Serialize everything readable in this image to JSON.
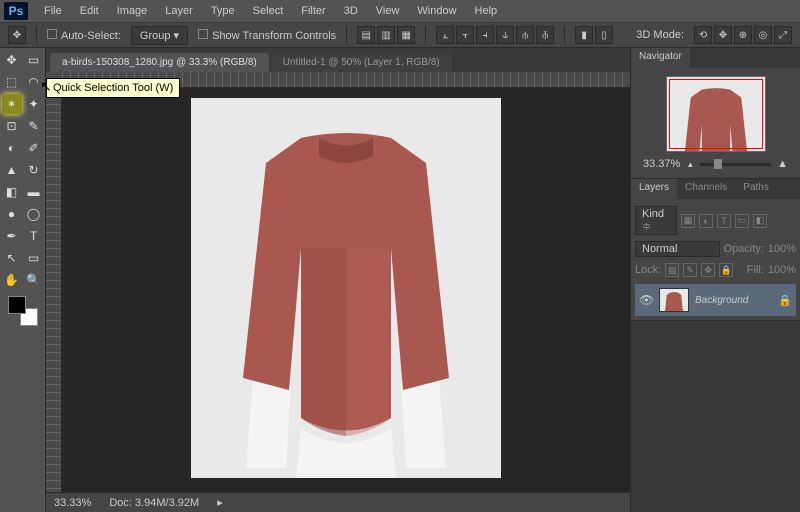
{
  "menu": {
    "items": [
      "File",
      "Edit",
      "Image",
      "Layer",
      "Type",
      "Select",
      "Filter",
      "3D",
      "View",
      "Window",
      "Help"
    ],
    "logo": "Ps"
  },
  "options": {
    "auto_select": "Auto-Select:",
    "group": "Group",
    "show_tc": "Show Transform Controls",
    "mode": "3D Mode:"
  },
  "tabs": {
    "active": "a-birds-150308_1280.jpg @ 33.3% (RGB/8)",
    "inactive": "Untitled-1 @ 50% (Layer 1, RGB/8)"
  },
  "tooltip": "Quick Selection Tool (W)",
  "status": {
    "zoom": "33.33%",
    "doc": "Doc: 3.94M/3.92M"
  },
  "nav": {
    "title": "Navigator",
    "zoom": "33.37%"
  },
  "layers": {
    "tabs": [
      "Layers",
      "Channels",
      "Paths"
    ],
    "kind": "Kind",
    "blend": "Normal",
    "opacity_l": "Opacity:",
    "opacity_v": "100%",
    "lock_l": "Lock:",
    "fill_l": "Fill:",
    "fill_v": "100%",
    "bg": "Background"
  },
  "colors": {
    "shirt": "#a8584f",
    "bg": "#e8e8e8",
    "mannequin": "#f5f5f5"
  }
}
